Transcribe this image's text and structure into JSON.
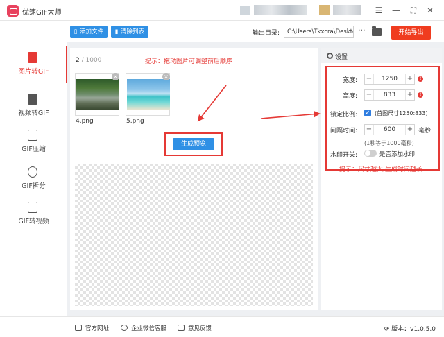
{
  "app": {
    "title": "优速GIF大师"
  },
  "window": {
    "menu": "☰",
    "minimize": "—",
    "maximize": "⛶",
    "close": "✕"
  },
  "toolbar": {
    "add_file": "添加文件",
    "clear_list": "清除列表",
    "output_label": "输出目录:",
    "output_path": "C:\\Users\\Tkxcra\\Deskto",
    "more": "···",
    "start_label": "开始导出"
  },
  "nav": {
    "items": [
      {
        "label": "图片转GIF",
        "icon": "image-icon",
        "active": true
      },
      {
        "label": "视频转GIF",
        "icon": "video-icon",
        "active": false
      },
      {
        "label": "GIF压缩",
        "icon": "compress-icon",
        "active": false
      },
      {
        "label": "GIF拆分",
        "icon": "split-icon",
        "active": false
      },
      {
        "label": "GIF转视频",
        "icon": "gif-icon",
        "active": false
      }
    ]
  },
  "center": {
    "count_current": "2",
    "count_total": " / 1000",
    "hint": "提示：拖动图片可调整前后顺序",
    "thumbs": [
      {
        "name": "4.png"
      },
      {
        "name": "5.png"
      }
    ],
    "generate_label": "生成预览"
  },
  "settings": {
    "title": "设置",
    "width_label": "宽度:",
    "width_value": "1250",
    "height_label": "高度:",
    "height_value": "833",
    "lock_label": "锁定比例:",
    "lock_note": "(首图尺寸1250:833)",
    "interval_label": "间隔时间:",
    "interval_value": "600",
    "interval_unit": "毫秒",
    "interval_note": "(1秒等于1000毫秒)",
    "watermark_label": "水印开关:",
    "watermark_note": "是否添加水印",
    "hint": "提示：尺寸越大,生成时间越长",
    "minus": "−",
    "plus": "+",
    "warn": "!"
  },
  "footer": {
    "site": "官方网址",
    "wechat": "企业微信客服",
    "feedback": "意见反馈",
    "version": "版本：v1.0.5.0"
  },
  "colors": {
    "accent": "#2f90e5",
    "danger": "#e53935",
    "export": "#f03c1f"
  }
}
